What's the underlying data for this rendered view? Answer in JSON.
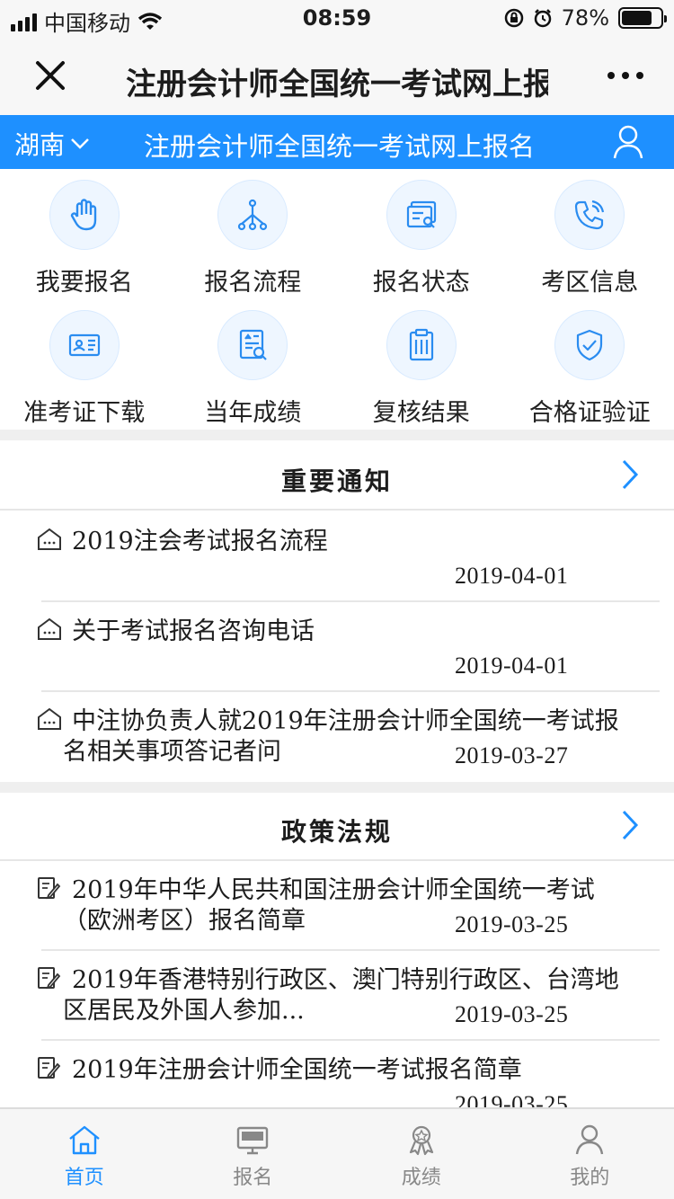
{
  "status": {
    "carrier": "中国移动",
    "time": "08:59",
    "battery": "78%",
    "battery_level": 0.78
  },
  "nav": {
    "title": "注册会计师全国统一考试网上报名"
  },
  "header": {
    "region": "湖南",
    "title": "注册会计师全国统一考试网上报名"
  },
  "grid": [
    {
      "label": "我要报名",
      "icon": "hand-icon"
    },
    {
      "label": "报名流程",
      "icon": "flow-icon"
    },
    {
      "label": "报名状态",
      "icon": "status-icon"
    },
    {
      "label": "考区信息",
      "icon": "phone-icon"
    },
    {
      "label": "准考证下载",
      "icon": "id-card-icon"
    },
    {
      "label": "当年成绩",
      "icon": "score-search-icon"
    },
    {
      "label": "复核结果",
      "icon": "clipboard-icon"
    },
    {
      "label": "合格证验证",
      "icon": "shield-check-icon"
    }
  ],
  "notices": {
    "title": "重要通知",
    "items": [
      {
        "text": "2019注会考试报名流程",
        "date": "2019-04-01"
      },
      {
        "text": "关于考试报名咨询电话",
        "date": "2019-04-01"
      },
      {
        "text": "中注协负责人就2019年注册会计师全国统一考试报名相关事项答记者问",
        "date": "2019-03-27"
      }
    ]
  },
  "policies": {
    "title": "政策法规",
    "items": [
      {
        "text": "2019年中华人民共和国注册会计师全国统一考试（欧洲考区）报名简章",
        "date": "2019-03-25"
      },
      {
        "text": "2019年香港特别行政区、澳门特别行政区、台湾地区居民及外国人参加...",
        "date": "2019-03-25"
      },
      {
        "text": "2019年注册会计师全国统一考试报名简章",
        "date": "2019-03-25"
      }
    ]
  },
  "tabs": [
    {
      "label": "首页",
      "icon": "home-icon"
    },
    {
      "label": "报名",
      "icon": "monitor-icon"
    },
    {
      "label": "成绩",
      "icon": "award-icon"
    },
    {
      "label": "我的",
      "icon": "person-icon"
    }
  ],
  "colors": {
    "accent": "#1e90ff",
    "icon_blue": "#2a8cf0",
    "bg_sep": "#efefef"
  }
}
